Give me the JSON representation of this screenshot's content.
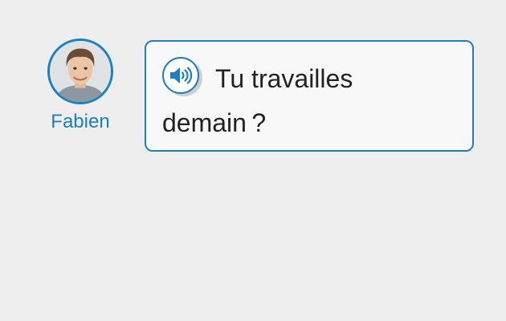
{
  "speaker": {
    "name": "Fabien",
    "accent_color": "#1b7fc4"
  },
  "message": {
    "text": "Tu travailles demain ?",
    "audio_icon": "speaker-volume-icon"
  }
}
